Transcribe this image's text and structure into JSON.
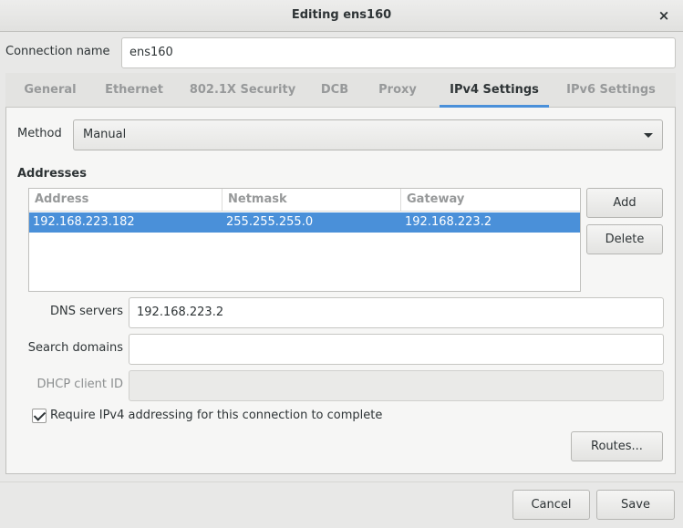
{
  "window": {
    "title": "Editing ens160",
    "close_glyph": "×"
  },
  "connection": {
    "label": "Connection name",
    "value": "ens160"
  },
  "tabs": [
    {
      "label": "General",
      "active": false
    },
    {
      "label": "Ethernet",
      "active": false
    },
    {
      "label": "802.1X Security",
      "active": false
    },
    {
      "label": "DCB",
      "active": false
    },
    {
      "label": "Proxy",
      "active": false
    },
    {
      "label": "IPv4 Settings",
      "active": true
    },
    {
      "label": "IPv6 Settings",
      "active": false
    }
  ],
  "ipv4": {
    "method_label": "Method",
    "method_value": "Manual",
    "addresses_heading": "Addresses",
    "table": {
      "columns": [
        "Address",
        "Netmask",
        "Gateway"
      ],
      "rows": [
        {
          "address": "192.168.223.182",
          "netmask": "255.255.255.0",
          "gateway": "192.168.223.2",
          "selected": true
        }
      ]
    },
    "add_label": "Add",
    "delete_label": "Delete",
    "dns_label": "DNS servers",
    "dns_value": "192.168.223.2",
    "search_label": "Search domains",
    "search_value": "",
    "dhcp_label": "DHCP client ID",
    "dhcp_value": "",
    "require_label": "Require IPv4 addressing for this connection to complete",
    "require_checked": true,
    "routes_label": "Routes..."
  },
  "footer": {
    "cancel_label": "Cancel",
    "save_label": "Save"
  },
  "colors": {
    "accent": "#4a90d9",
    "background": "#e8e8e7"
  }
}
